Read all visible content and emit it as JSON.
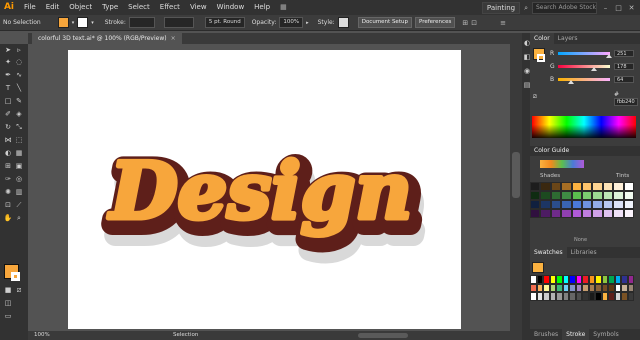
{
  "app": {
    "logo": "Ai"
  },
  "menu": [
    "File",
    "Edit",
    "Object",
    "Type",
    "Select",
    "Effect",
    "View",
    "Window",
    "Help"
  ],
  "workspace": "Painting",
  "search_placeholder": "Search Adobe Stock",
  "control": {
    "selection": "No Selection",
    "stroke_label": "Stroke:",
    "brush": "5 pt. Round",
    "opacity_label": "Opacity:",
    "opacity_value": "100%",
    "style_label": "Style:",
    "doc_setup": "Document Setup",
    "preferences": "Preferences"
  },
  "document": {
    "tab_title": "colorful 3D text.ai* @ 100% (RGB/Preview)",
    "close": "×"
  },
  "artwork_text": "Design",
  "status": {
    "zoom": "100%",
    "mode": "Selection"
  },
  "color_panel": {
    "tabs": [
      "Color",
      "Layers"
    ],
    "channels": [
      {
        "label": "R",
        "value": "251",
        "level": 0.98,
        "gradient": [
          "#00a6ff",
          "#ffa6ff"
        ]
      },
      {
        "label": "G",
        "value": "178",
        "level": 0.7,
        "gradient": [
          "#fb0040",
          "#fbffd0"
        ]
      },
      {
        "label": "B",
        "value": "64",
        "level": 0.25,
        "gradient": [
          "#fbb200",
          "#fbb2ff"
        ]
      }
    ],
    "hex_prefix": "#",
    "hex": "fbb240",
    "fill_color": "#fbb240"
  },
  "color_guide": {
    "title": "Color Guide",
    "shades": "Shades",
    "tints": "Tints",
    "none": "None"
  },
  "swatches_panel": {
    "tabs": [
      "Swatches",
      "Libraries"
    ]
  },
  "bottom_tabs": [
    "Brushes",
    "Stroke",
    "Symbols"
  ],
  "colors": {
    "accent": "#f7a63c",
    "fill": "#fbb240",
    "stroke": "#5e1f1a",
    "shadow": "#d4d4d4"
  }
}
